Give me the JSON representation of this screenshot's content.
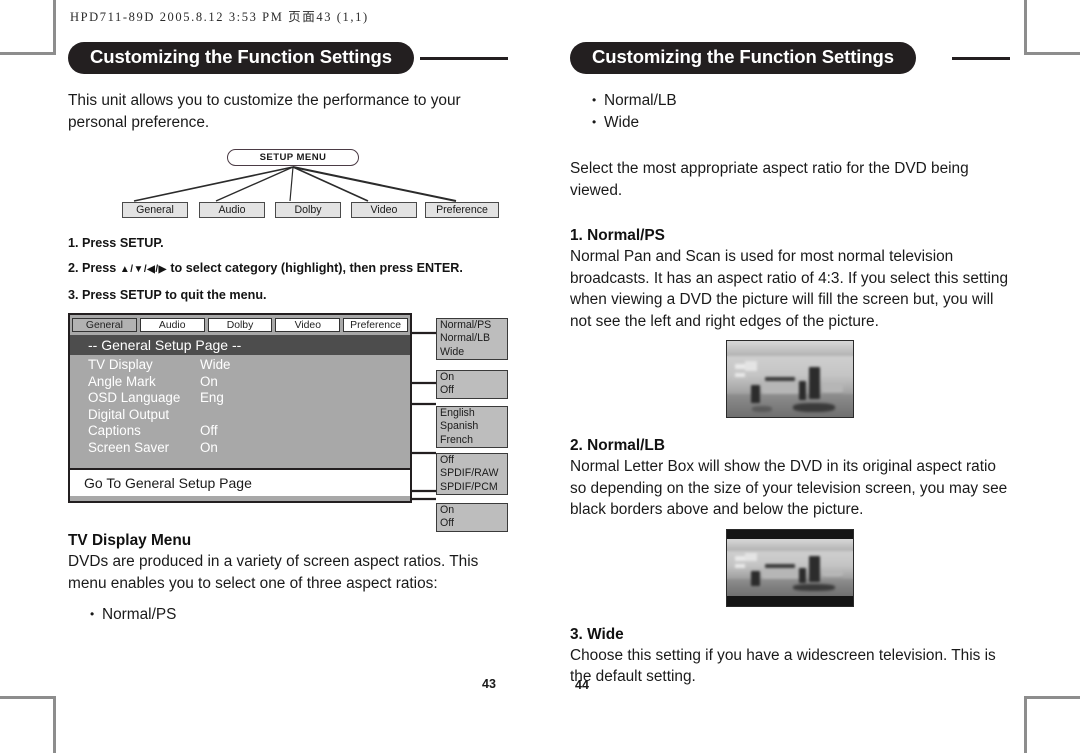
{
  "running_header": "HPD711-89D  2005.8.12 3:53 PM  页面43 (1,1)",
  "left_page": {
    "banner_title": "Customizing the Function Settings",
    "intro": "This unit allows you to customize the performance to your personal preference.",
    "tree": {
      "root": "SETUP MENU",
      "leaves": [
        "General",
        "Audio",
        "Dolby",
        "Video",
        "Preference"
      ]
    },
    "steps": {
      "step1": "1. Press SETUP.",
      "step2_pre": "2. Press ",
      "step2_arrows": "▲/▼/◀/▶",
      "step2_post": " to select category (highlight), then press ENTER.",
      "step3": "3. Press SETUP to quit the menu."
    },
    "osd": {
      "tabs": [
        "General",
        "Audio",
        "Dolby",
        "Video",
        "Preference"
      ],
      "active_tab": "General",
      "header": "-- General Setup Page --",
      "rows": [
        {
          "label": "TV Display",
          "value": "Wide"
        },
        {
          "label": "Angle Mark",
          "value": "On"
        },
        {
          "label": "OSD Language",
          "value": "Eng"
        },
        {
          "label": "Digital Output",
          "value": ""
        },
        {
          "label": "Captions",
          "value": "Off"
        },
        {
          "label": "Screen Saver",
          "value": "On"
        }
      ],
      "footer": "Go To General Setup Page",
      "callouts": [
        {
          "items": [
            "Normal/PS",
            "Normal/LB",
            "Wide"
          ]
        },
        {
          "items": [
            "On",
            "Off"
          ]
        },
        {
          "items": [
            "English",
            "Spanish",
            "French"
          ]
        },
        {
          "items": [
            "Off",
            "SPDIF/RAW",
            "SPDIF/PCM"
          ]
        },
        {
          "items": [
            "On",
            "Off"
          ]
        }
      ]
    },
    "tv_display_menu": {
      "heading": "TV Display Menu",
      "body": "DVDs are produced in a variety of screen aspect ratios. This menu enables you to select one of three aspect ratios:",
      "bullet1": "Normal/PS"
    },
    "page_number": "43"
  },
  "right_page": {
    "banner_title": "Customizing the Function Settings",
    "bullet2": "Normal/LB",
    "bullet3": "Wide",
    "select_text": "Select the most appropriate aspect ratio for the DVD being viewed.",
    "sections": [
      {
        "heading": "1. Normal/PS",
        "body": "Normal Pan and Scan is used for most normal television broadcasts. It has an aspect ratio of 4:3. If you select this setting when viewing a DVD the picture will fill the screen but, you will not see the left and right edges of the picture."
      },
      {
        "heading": "2. Normal/LB",
        "body": "Normal Letter Box will show the DVD in its original aspect ratio so depending on the size of your television screen, you may see black borders above and below the picture."
      },
      {
        "heading": "3. Wide",
        "body": "Choose this setting if you have a widescreen television. This is the default setting."
      }
    ],
    "page_number": "44"
  },
  "colors": {
    "banner_bg": "#231f20",
    "osd_bg": "#a8a8a8",
    "osd_header_bg": "#4d4d4d",
    "callout_bg": "#bdbdbd"
  }
}
